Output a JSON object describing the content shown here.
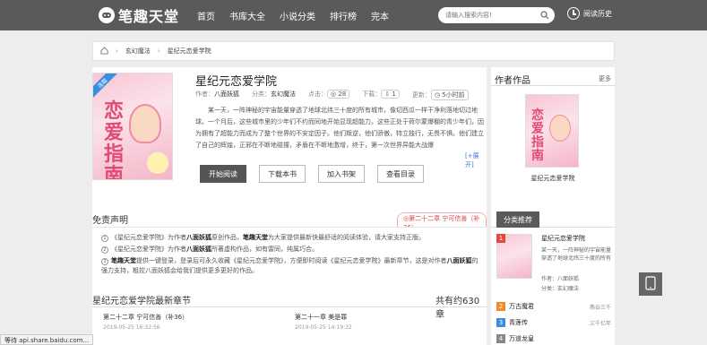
{
  "header": {
    "logo_text": "笔趣天堂",
    "nav": [
      "首页",
      "书库大全",
      "小说分类",
      "排行榜",
      "完本"
    ],
    "search_placeholder": "请输入搜索内容!",
    "history_label": "阅读历史"
  },
  "breadcrumb": {
    "items": [
      "玄幻魔法",
      "星纪元恋爱学院"
    ]
  },
  "book": {
    "title": "星纪元恋爱学院",
    "ribbon": "连载",
    "cover_title": "恋爱指南",
    "author_label": "作者：",
    "author": "八面妖狐",
    "category_label": "分类：",
    "category": "玄幻魔法",
    "clicks_label": "点击：",
    "clicks": "28",
    "downloads_label": "下载：",
    "downloads": "1",
    "updated_label": "更新：",
    "updated": "5小时前",
    "description": "某一天，一阵神秘的宇宙能量穿透了地球北纬三十度的所有城市，像切西瓜一样干净利落地切过地球。一个月后，这些城市里的少年们不约而同地开始显现超能力。这些正处于荷尔蒙爆棚的青少年们，因为拥有了超能力而成为了整个世界的不安定因子。他们叛逆，他们骄傲，特立独行，无畏不惧。他们建立了自己的辉煌，正邪在不断地碰撞，矛盾在不断地激增，终于，第一次世界异能大战爆",
    "expand": "[+展开]",
    "buttons": [
      "开始阅读",
      "下载本书",
      "加入书架",
      "查看目录"
    ]
  },
  "disclaimer": {
    "title": "免责声明",
    "latest_tag": "◎第二十二章 宁可信善（补36）",
    "lines": [
      {
        "num": "1",
        "parts": [
          "《星纪元恋爱学院》为作者",
          "八面妖狐",
          "原创作品，",
          "笔趣天堂",
          "为大家提供最新快最舒适的阅读体验，请大家支持正版。"
        ]
      },
      {
        "num": "2",
        "parts": [
          "《星纪元恋爱学院》为作者",
          "八面妖狐",
          "所著虚构作品，如有雷同，纯属巧合。"
        ]
      },
      {
        "num": "3",
        "parts": [
          "",
          "笔趣天堂",
          "提供一键登录，登录后可永久收藏《星纪元恋爱学院》，方便即时阅读《星纪元恋爱学院》最新章节，这是对作者",
          "八面妖狐",
          "的强力支持，粗控八面妖狐会给我们提供更多更好的作品。"
        ]
      }
    ]
  },
  "chapters": {
    "title": "星纪元恋爱学院最新章节",
    "count": "共有约630章",
    "items": [
      {
        "title": "第二十二章 宁可信善（补36）",
        "date": "2019-05-25 16:32:56"
      },
      {
        "title": "第二十一章 美是罪",
        "date": "2019-05-25 14:19:32"
      }
    ]
  },
  "sidebar": {
    "author_works_title": "作者作品",
    "more": "更多",
    "work_name": "星纪元恋爱学院",
    "work_cover_title": "恋爱指南",
    "category_tab": "分类推荐",
    "rec": {
      "num": "1",
      "title": "星纪元恋爱学院",
      "desc": "某一天，一阵神秘的宇宙能量穿透了地球北纬三十度的所有",
      "author": "作者：八面妖狐",
      "category": "分类：玄幻魔法"
    },
    "ranks": [
      {
        "num": "2",
        "title": "万古魔君",
        "right": "燕云三千",
        "color": "#f08a2c"
      },
      {
        "num": "3",
        "title": "青莲传",
        "right": "三千亿年",
        "color": "#3b8de0"
      },
      {
        "num": "4",
        "title": "万道龙皇",
        "right": "",
        "color": "#888888"
      }
    ]
  },
  "status_bar": "等待 api.share.baidu.com..."
}
